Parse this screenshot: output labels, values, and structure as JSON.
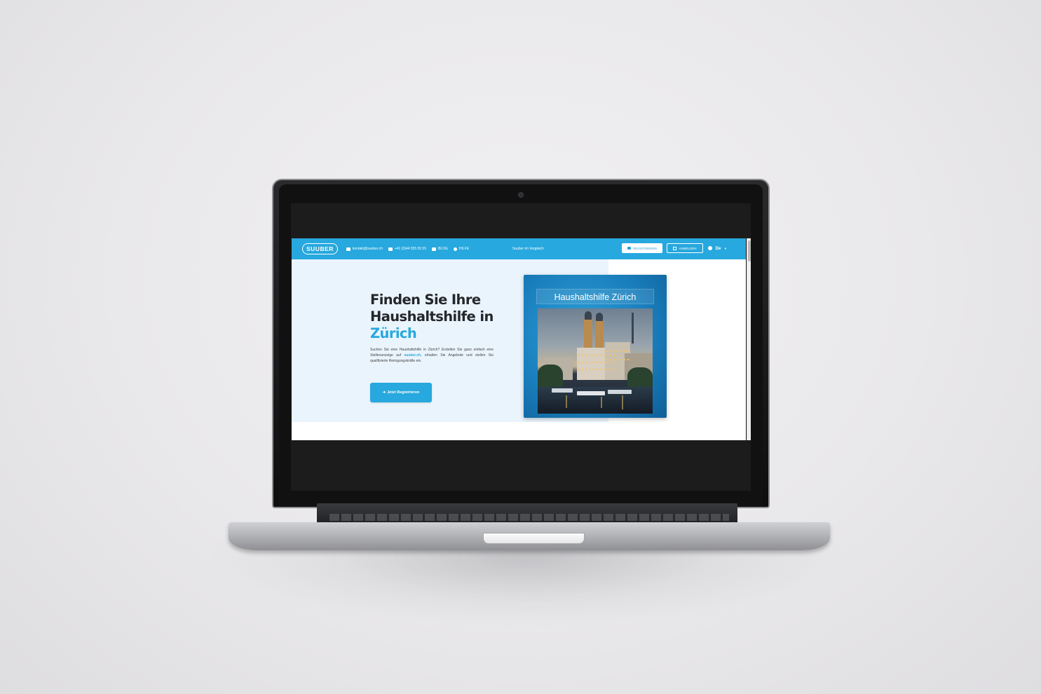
{
  "site": {
    "logo": "SUUBER",
    "nav": {
      "email": "kontakt@suuber.ch",
      "phone": "+41 (0)44 555 55 55",
      "blog": "BLOG",
      "help": "HILFE",
      "compare": "Suuber im Vergleich",
      "register": "REGISTRIEREN",
      "login": "ANMELDEN",
      "language": "De"
    },
    "hero": {
      "title_line1": "Finden Sie Ihre",
      "title_line2": "Haushaltshilfe in",
      "title_city": "Zürich",
      "desc_part1": "Suchen Sie eine Haushaltshilfe in Zürich? Erstellen Sie ganz einfach eine Stellenanzeige auf",
      "desc_link": "suuber.ch",
      "desc_part2": ", erhalten Sie Angebote und stellen Sie qualifizierte Reinigungskräfte ein.",
      "cta": "Jetzt Registrieren"
    },
    "card": {
      "title": "Haushaltshilfe Zürich"
    }
  },
  "colors": {
    "brand": "#27a8de",
    "hero_bg": "#eaf4fd",
    "heading": "#242729"
  },
  "icons": [
    "envelope-icon",
    "phone-icon",
    "blog-icon",
    "help-icon",
    "user-plus-icon",
    "login-icon",
    "globe-icon",
    "chevron-down-icon"
  ]
}
